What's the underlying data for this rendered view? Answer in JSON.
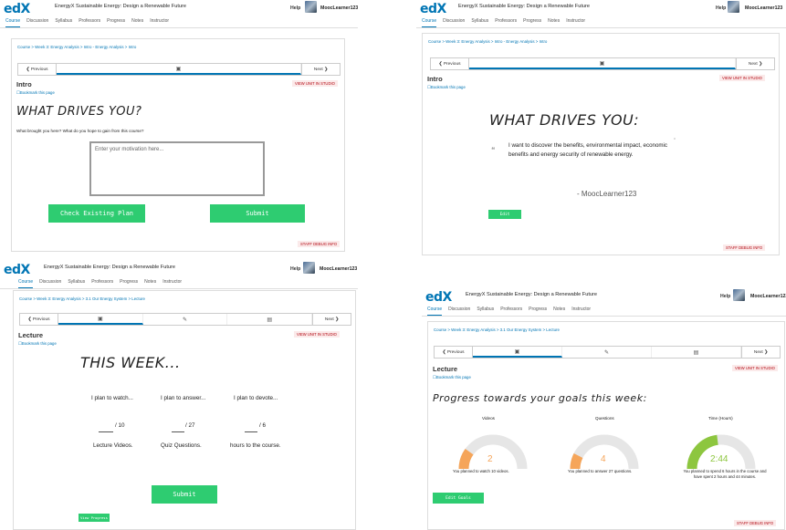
{
  "common": {
    "logo": "edX",
    "course_title": "EnergyX Sustainable Energy: Design a Renewable Future",
    "help": "Help",
    "username": "MoocLearner123",
    "nav": [
      "Course",
      "Discussion",
      "Syllabus",
      "Professors",
      "Progress",
      "Notes",
      "Instructor"
    ],
    "previous": "Previous",
    "next": "Next",
    "bookmark": "Bookmark this page",
    "view_studio": "VIEW UNIT IN STUDIO",
    "staff_debug": "STAFF DEBUG INFO"
  },
  "panel1": {
    "breadcrumb": "Course > Week 3: Energy Analysis > Intro - Energy Analysis > Intro",
    "unit_title": "Intro",
    "heading": "WHAT DRIVES YOU?",
    "question": "What brought you here? What do you hope to gain from this course?",
    "placeholder": "Enter your motivation here...",
    "btn_check": "Check Existing Plan",
    "btn_submit": "Submit"
  },
  "panel2": {
    "breadcrumb": "Course > Week 3: Energy Analysis > Intro - Energy Analysis > Intro",
    "unit_title": "Intro",
    "heading": "WHAT DRIVES YOU:",
    "quote": "I want to discover the benefits, environmental impact, economic benefits and energy security of renewable energy.",
    "attribution": "- MoocLearner123",
    "btn_edit": "Edit"
  },
  "panel3": {
    "breadcrumb": "Course > Week 3: Energy Analysis > 3.1 Our Energy System > Lecture",
    "unit_title": "Lecture",
    "heading": "THIS WEEK...",
    "col1_label": "I plan to watch...",
    "col2_label": "I plan to answer...",
    "col3_label": "I plan to devote...",
    "col1_total": "/ 10",
    "col2_total": "/ 27",
    "col3_total": "/ 6",
    "col1_unit": "Lecture Videos.",
    "col2_unit": "Quiz Questions.",
    "col3_unit": "hours to the course.",
    "btn_submit": "Submit",
    "btn_progress": "View Progress"
  },
  "panel4": {
    "breadcrumb": "Course > Week 3: Energy Analysis > 3.1 Our Energy System > Lecture",
    "unit_title": "Lecture",
    "heading": "Progress towards your goals this week:",
    "g1_title": "Videos",
    "g2_title": "Questions",
    "g3_title": "Time (Hours)",
    "g1_value": "2",
    "g2_value": "4",
    "g3_value": "2:44",
    "g1_fraction": 0.2,
    "g2_fraction": 0.15,
    "g3_fraction": 0.46,
    "g1_caption": "You planned to watch 10 videos.",
    "g2_caption": "You planned to answer 27 questions.",
    "g3_caption": "You planned to spend 6 hours in the course and have spent 2 hours and 44 minutes.",
    "btn_edit_goals": "Edit Goals"
  },
  "colors": {
    "accent": "#0075b4",
    "green": "#2ecc71",
    "orange": "#f5a55a",
    "lime": "#8dc63f"
  }
}
